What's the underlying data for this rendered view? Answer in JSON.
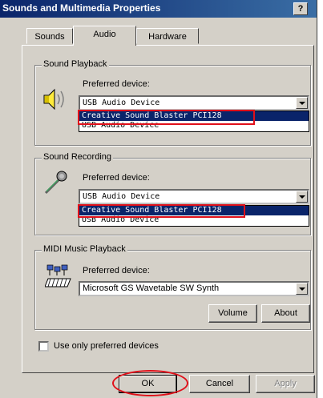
{
  "window": {
    "title": "Sounds and Multimedia Properties",
    "help_label": "?"
  },
  "tabs": [
    {
      "label": "Sounds",
      "active": false
    },
    {
      "label": "Audio",
      "active": true
    },
    {
      "label": "Hardware",
      "active": false
    }
  ],
  "playback": {
    "legend": "Sound Playback",
    "label": "Preferred device:",
    "selected": "USB Audio Device",
    "options": [
      "Creative Sound Blaster PCI128",
      "USB Audio Device"
    ],
    "highlighted": "Creative Sound Blaster PCI128",
    "icon": "speaker-icon"
  },
  "recording": {
    "legend": "Sound Recording",
    "label": "Preferred device:",
    "selected": "USB Audio Device",
    "options": [
      "Creative Sound Blaster PCI128",
      "USB Audio Device"
    ],
    "highlighted": "Creative Sound Blaster PCI128",
    "icon": "microphone-icon"
  },
  "midi": {
    "legend": "MIDI Music Playback",
    "label": "Preferred device:",
    "selected": "Microsoft GS Wavetable SW Synth",
    "volume_label": "Volume",
    "about_label": "About",
    "icon": "midi-keyboard-icon"
  },
  "preferred_only": {
    "label": "Use only preferred devices",
    "checked": false
  },
  "footer": {
    "ok": "OK",
    "cancel": "Cancel",
    "apply": "Apply"
  },
  "colors": {
    "title_bar": "#0a246a",
    "annotation": "#e0101a",
    "selection": "#0a246a",
    "face": "#d4d0c8"
  }
}
